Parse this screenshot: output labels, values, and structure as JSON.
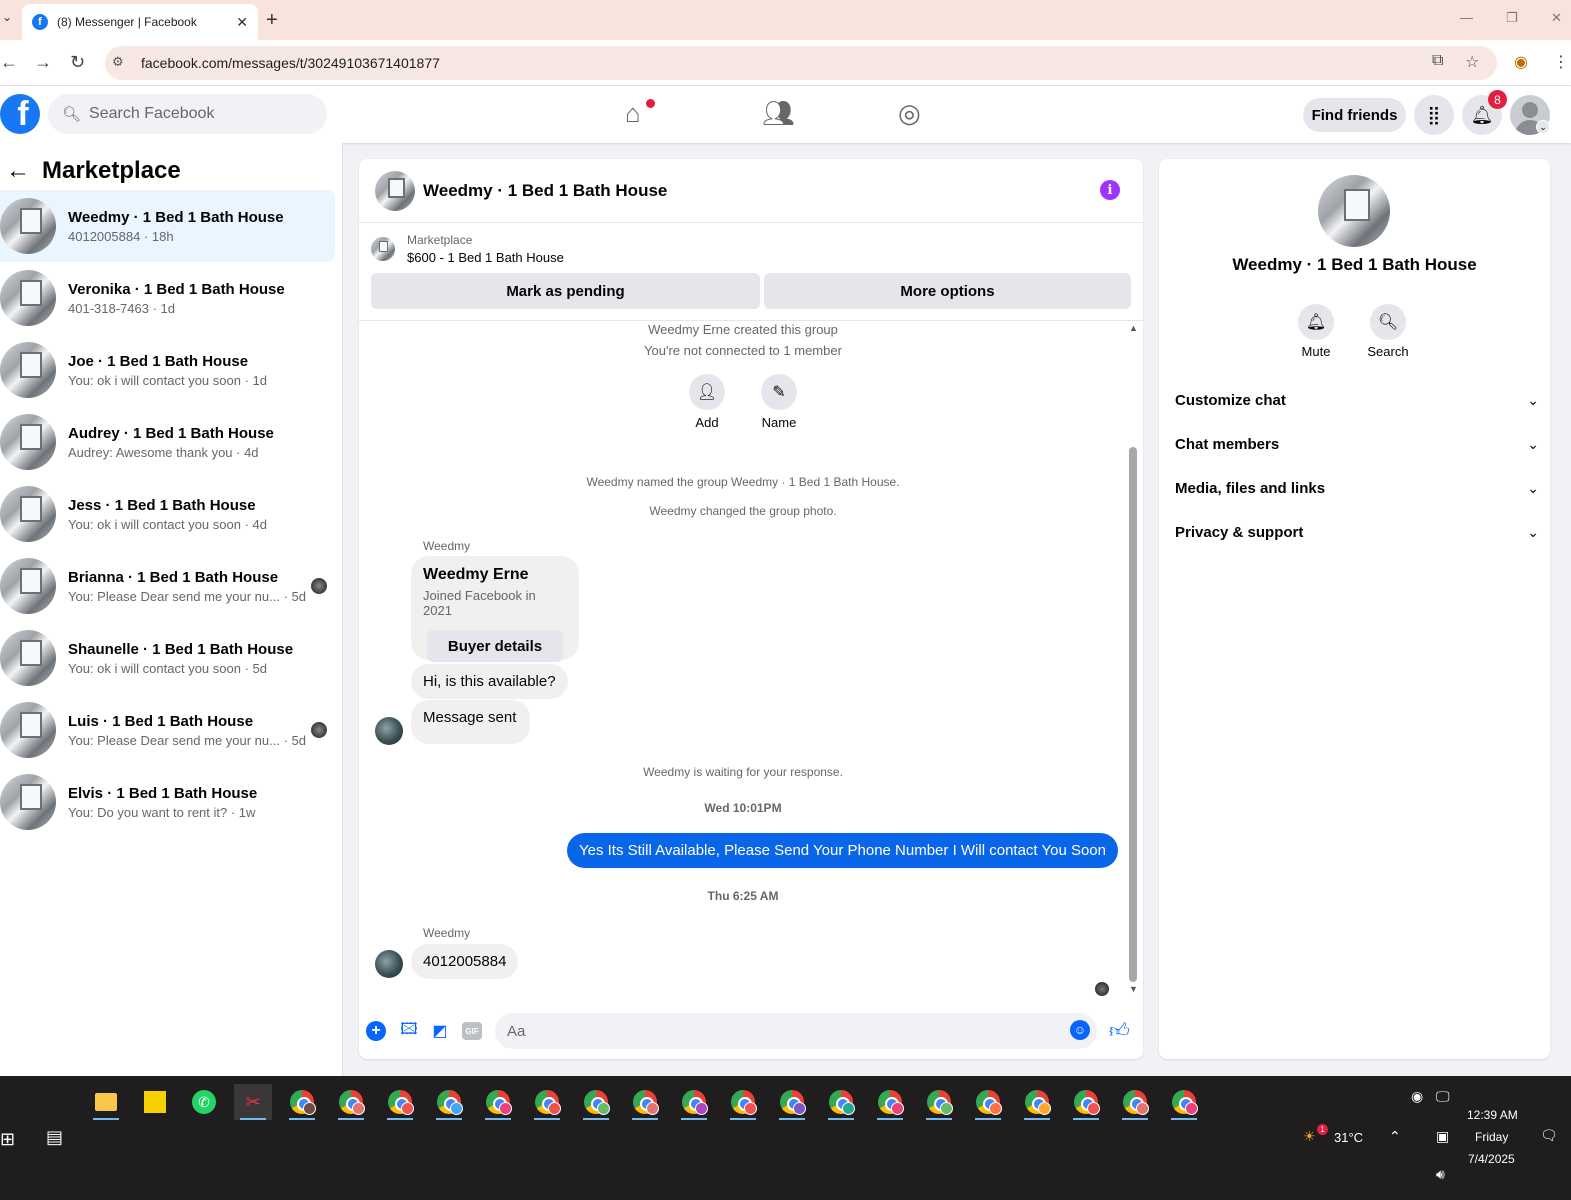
{
  "browser": {
    "tab_title": "(8) Messenger | Facebook",
    "url": "facebook.com/messages/t/30249103671401877"
  },
  "fb": {
    "search_placeholder": "Search Facebook",
    "find_friends": "Find friends",
    "notification_count": "8"
  },
  "left": {
    "title": "Marketplace",
    "conversations": [
      {
        "name": "Weedmy · 1 Bed 1 Bath House",
        "sub": "4012005884 · 18h",
        "active": true
      },
      {
        "name": "Veronika · 1 Bed 1 Bath House",
        "sub": "401-318-7463 · 1d"
      },
      {
        "name": "Joe · 1 Bed 1 Bath House",
        "sub": "You: ok i will contact you soon · 1d"
      },
      {
        "name": "Audrey · 1 Bed 1 Bath House",
        "sub": "Audrey: Awesome thank you · 4d"
      },
      {
        "name": "Jess · 1 Bed 1 Bath House",
        "sub": "You: ok i will contact you soon · 4d"
      },
      {
        "name": "Brianna · 1 Bed 1 Bath House",
        "sub": "You: Please Dear send me your nu...",
        "time": "· 5d",
        "seen": true
      },
      {
        "name": "Shaunelle · 1 Bed 1 Bath House",
        "sub": "You: ok i will contact you soon · 5d"
      },
      {
        "name": "Luis · 1 Bed 1 Bath House",
        "sub": "You: Please Dear send me your nu...",
        "time": "· 5d",
        "seen": true
      },
      {
        "name": "Elvis · 1 Bed 1 Bath House",
        "sub": "You: Do you want to rent it? · 1w"
      }
    ]
  },
  "chat": {
    "title": "Weedmy · 1 Bed 1 Bath House",
    "marketplace_label": "Marketplace",
    "listing": "$600 - 1 Bed 1 Bath House",
    "mark_pending": "Mark as pending",
    "more_options": "More options",
    "created": "Weedmy Erne created this group",
    "not_connected": "You're not connected to 1 member",
    "add_label": "Add",
    "name_label": "Name",
    "named_group": "Weedmy named the group Weedmy · 1 Bed 1 Bath House.",
    "changed_photo": "Weedmy changed the group photo.",
    "sender1": "Weedmy",
    "card_name": "Weedmy Erne",
    "card_joined": "Joined Facebook in 2021",
    "buyer_details": "Buyer details",
    "msg_available": "Hi, is this available?",
    "msg_sent": "Message sent",
    "waiting": "Weedmy is waiting for your response.",
    "ts1": "Wed 10:01PM",
    "out_msg": "Yes Its Still Available, Please Send Your Phone Number I Will contact You Soon",
    "ts2": "Thu 6:25 AM",
    "sender2": "Weedmy",
    "msg_phone": "4012005884",
    "composer_placeholder": "Aa"
  },
  "right": {
    "name": "Weedmy · 1 Bed 1 Bath House",
    "mute": "Mute",
    "search": "Search",
    "sections": [
      "Customize chat",
      "Chat members",
      "Media, files and links",
      "Privacy & support"
    ]
  },
  "taskbar": {
    "temp": "31°C",
    "time": "12:39 AM",
    "day": "Friday",
    "date": "7/4/2025",
    "weather_badge": "1"
  }
}
